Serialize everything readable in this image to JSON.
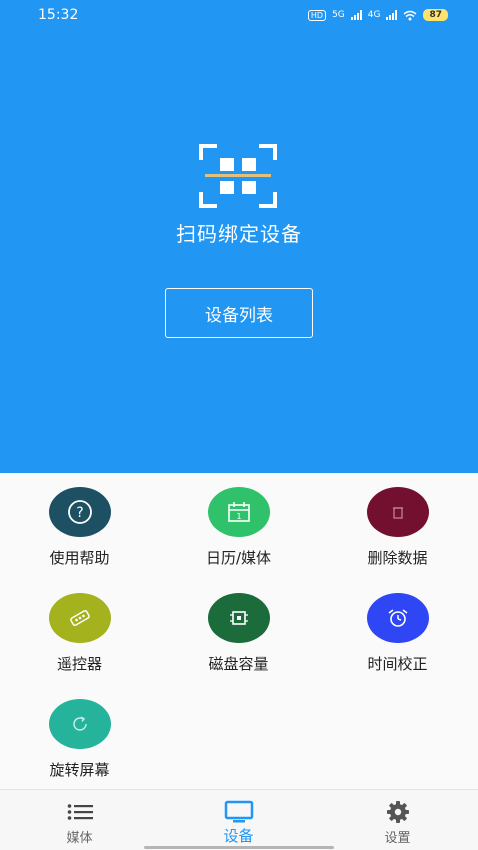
{
  "status_bar": {
    "time": "15:32",
    "hd_badge": "HD",
    "net1": "5G",
    "net2": "4G",
    "battery": "87"
  },
  "hero": {
    "title": "扫码绑定设备",
    "device_list_button": "设备列表"
  },
  "grid_items": [
    {
      "label": "使用帮助",
      "icon": "help-icon",
      "color": "#1e5063"
    },
    {
      "label": "日历/媒体",
      "icon": "calendar-icon",
      "color": "#2fc26a"
    },
    {
      "label": "删除数据",
      "icon": "trash-icon",
      "color": "#74102f"
    },
    {
      "label": "遥控器",
      "icon": "remote-icon",
      "color": "#a3b21d"
    },
    {
      "label": "磁盘容量",
      "icon": "chip-icon",
      "color": "#1c6b3a"
    },
    {
      "label": "时间校正",
      "icon": "alarm-clock-icon",
      "color": "#2f46f4"
    },
    {
      "label": "旋转屏幕",
      "icon": "rotate-icon",
      "color": "#26b39c"
    }
  ],
  "bottom_nav": [
    {
      "label": "媒体",
      "icon": "list-icon",
      "active": false
    },
    {
      "label": "设备",
      "icon": "monitor-icon",
      "active": true
    },
    {
      "label": "设置",
      "icon": "gear-icon",
      "active": false
    }
  ],
  "colors": {
    "primary": "#2196f3",
    "nav_inactive": "#666666"
  }
}
